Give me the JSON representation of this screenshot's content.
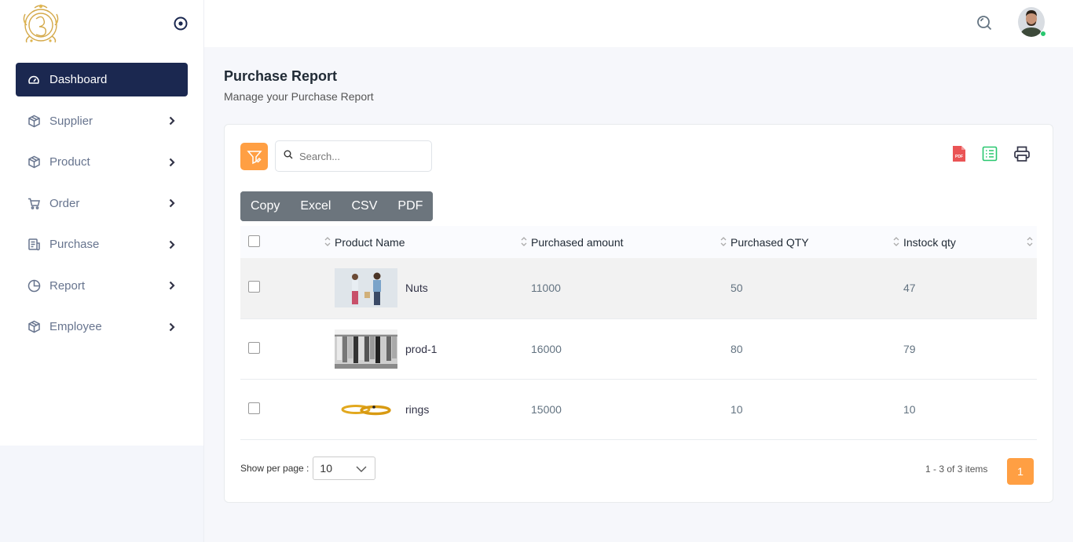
{
  "sidebar": {
    "items": [
      {
        "label": "Dashboard",
        "icon": "dashboard-gauge-icon",
        "active": true
      },
      {
        "label": "Supplier",
        "icon": "box-icon"
      },
      {
        "label": "Product",
        "icon": "box-icon"
      },
      {
        "label": "Order",
        "icon": "cart-icon"
      },
      {
        "label": "Purchase",
        "icon": "receipt-icon"
      },
      {
        "label": "Report",
        "icon": "pie-chart-icon"
      },
      {
        "label": "Employee",
        "icon": "box-icon"
      }
    ]
  },
  "page": {
    "title": "Purchase Report",
    "subtitle": "Manage your Purchase Report"
  },
  "search": {
    "placeholder": "Search..."
  },
  "export_buttons": [
    "Copy",
    "Excel",
    "CSV",
    "PDF"
  ],
  "table": {
    "columns": [
      "",
      "Product Name",
      "Purchased amount",
      "Purchased QTY",
      "Instock qty"
    ],
    "rows": [
      {
        "name": "Nuts",
        "amount": "11000",
        "qty": "50",
        "instock": "47"
      },
      {
        "name": "prod-1",
        "amount": "16000",
        "qty": "80",
        "instock": "79"
      },
      {
        "name": "rings",
        "amount": "15000",
        "qty": "10",
        "instock": "10"
      }
    ]
  },
  "pagination": {
    "per_page_label": "Show per page :",
    "per_page_value": "10",
    "info": "1 - 3 of 3 items",
    "current_page": "1"
  },
  "colors": {
    "accent": "#ff9f43",
    "nav_active": "#1b2850",
    "pdf": "#ea5455",
    "excel": "#28c76f"
  }
}
